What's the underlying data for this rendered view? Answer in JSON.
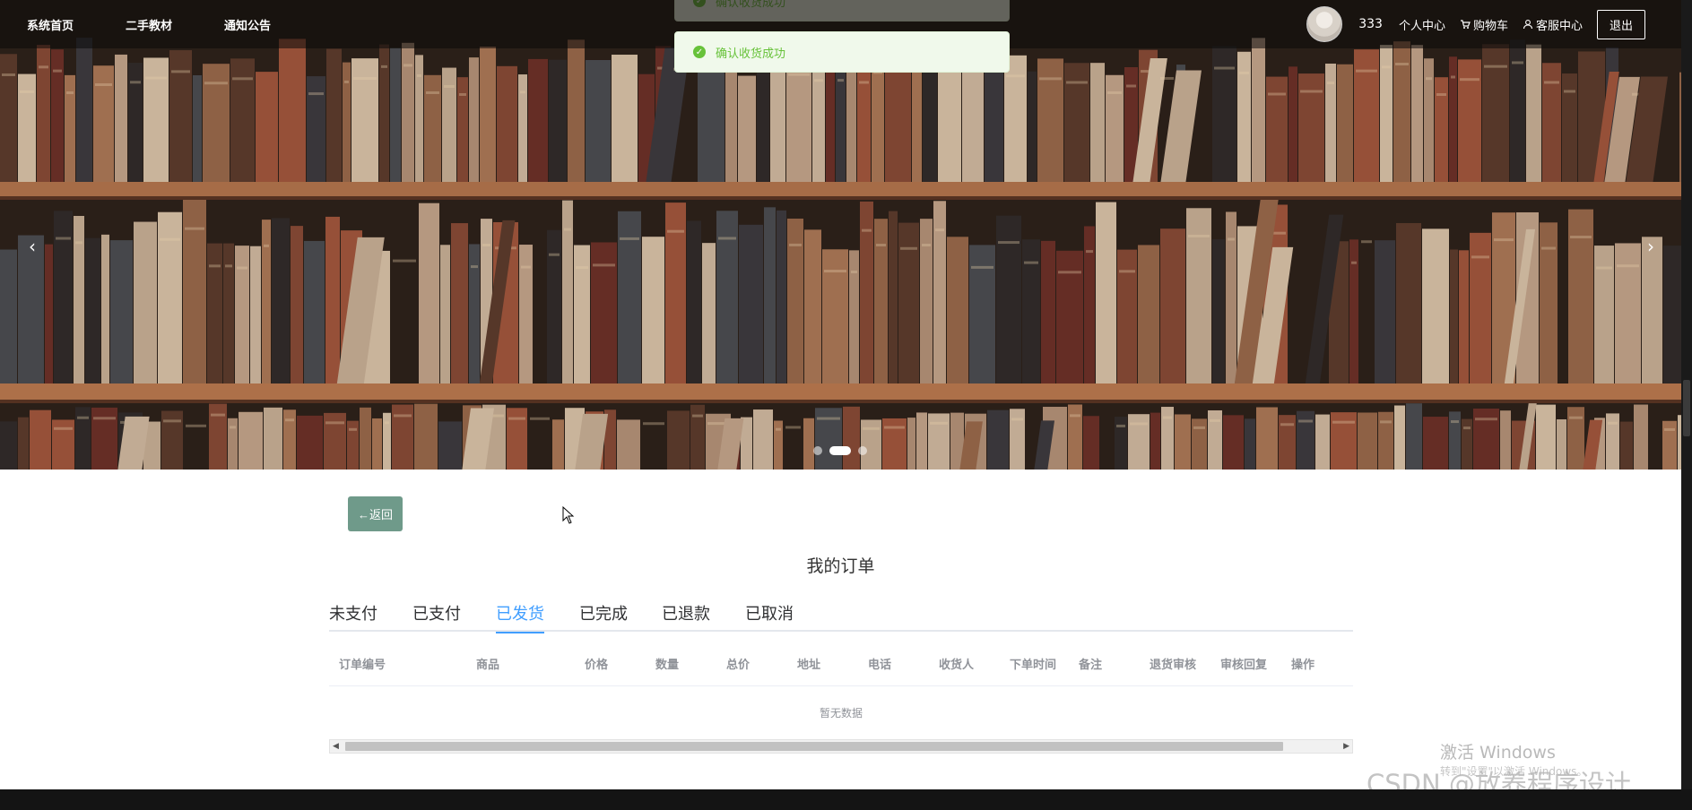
{
  "nav": {
    "links": [
      "系统首页",
      "二手教材",
      "通知公告"
    ],
    "username": "333",
    "user_center": "个人中心",
    "cart": "购物车",
    "service": "客服中心",
    "logout": "退出"
  },
  "toasts": {
    "old": "确认收货成功",
    "current": "确认收货成功"
  },
  "carousel": {
    "prev": "‹",
    "next": "›",
    "slide_count": 3,
    "active_index": 1
  },
  "back_label": "←返回",
  "page_title": "我的订单",
  "tabs": [
    "未支付",
    "已支付",
    "已发货",
    "已完成",
    "已退款",
    "已取消"
  ],
  "active_tab": "已发货",
  "table": {
    "headers": [
      "订单编号",
      "商品",
      "价格",
      "数量",
      "总价",
      "地址",
      "电话",
      "收货人",
      "下单时间",
      "备注",
      "退货审核",
      "审核回复",
      "操作"
    ],
    "empty_text": "暂无数据"
  },
  "watermarks": {
    "windows_title": "激活 Windows",
    "windows_sub": "转到\"设置\"以激活 Windows。",
    "csdn": "CSDN @放养程序设计"
  },
  "colors": {
    "accent": "#409eff",
    "success": "#67c23a",
    "back_button": "#6f9a8a"
  }
}
